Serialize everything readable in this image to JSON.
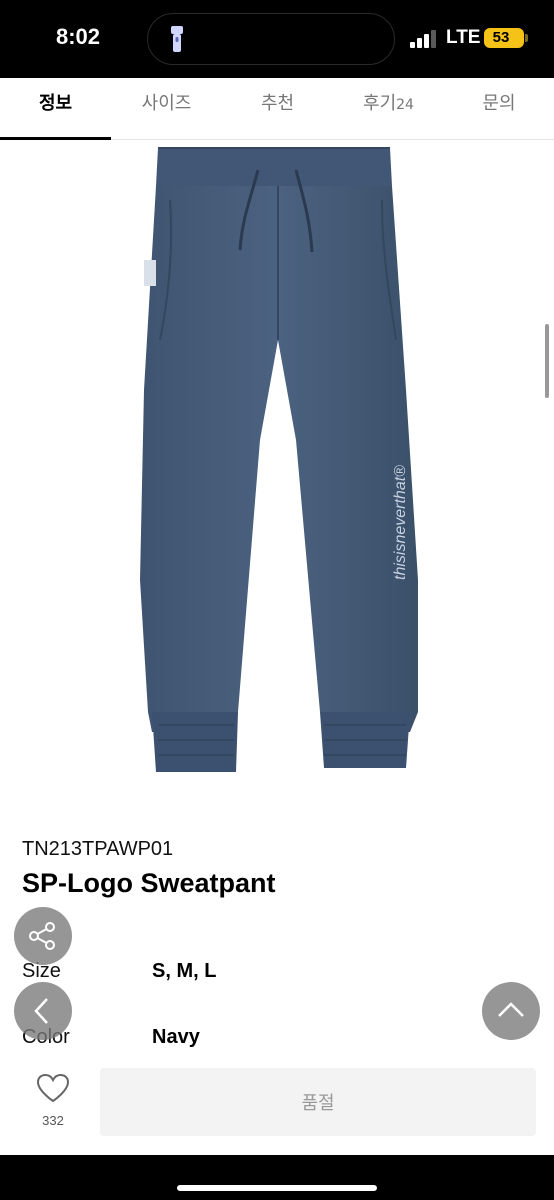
{
  "status_bar": {
    "time": "8:02",
    "network": "LTE",
    "battery": "53",
    "battery_color": "#f5c218"
  },
  "tabs": [
    {
      "label": "정보",
      "active": true
    },
    {
      "label": "사이즈"
    },
    {
      "label": "추천"
    },
    {
      "label": "후기",
      "count": "24"
    },
    {
      "label": "문의"
    }
  ],
  "product": {
    "image_alt_icon": "sweatpant-product-image",
    "brand_print": "thisisneverthat®",
    "sku": "TN213TPAWP01",
    "title": "SP-Logo Sweatpant",
    "specs": [
      {
        "label": "Size",
        "value": "S, M, L"
      },
      {
        "label": "Color",
        "value": "Navy"
      }
    ],
    "product_color": "#4a5f7a"
  },
  "actions": {
    "share_icon": "share-icon",
    "back_icon": "chevron-left-icon",
    "scroll_top_icon": "chevron-up-icon",
    "like_icon": "heart-icon",
    "like_count": "332",
    "primary_button_label": "품절"
  }
}
